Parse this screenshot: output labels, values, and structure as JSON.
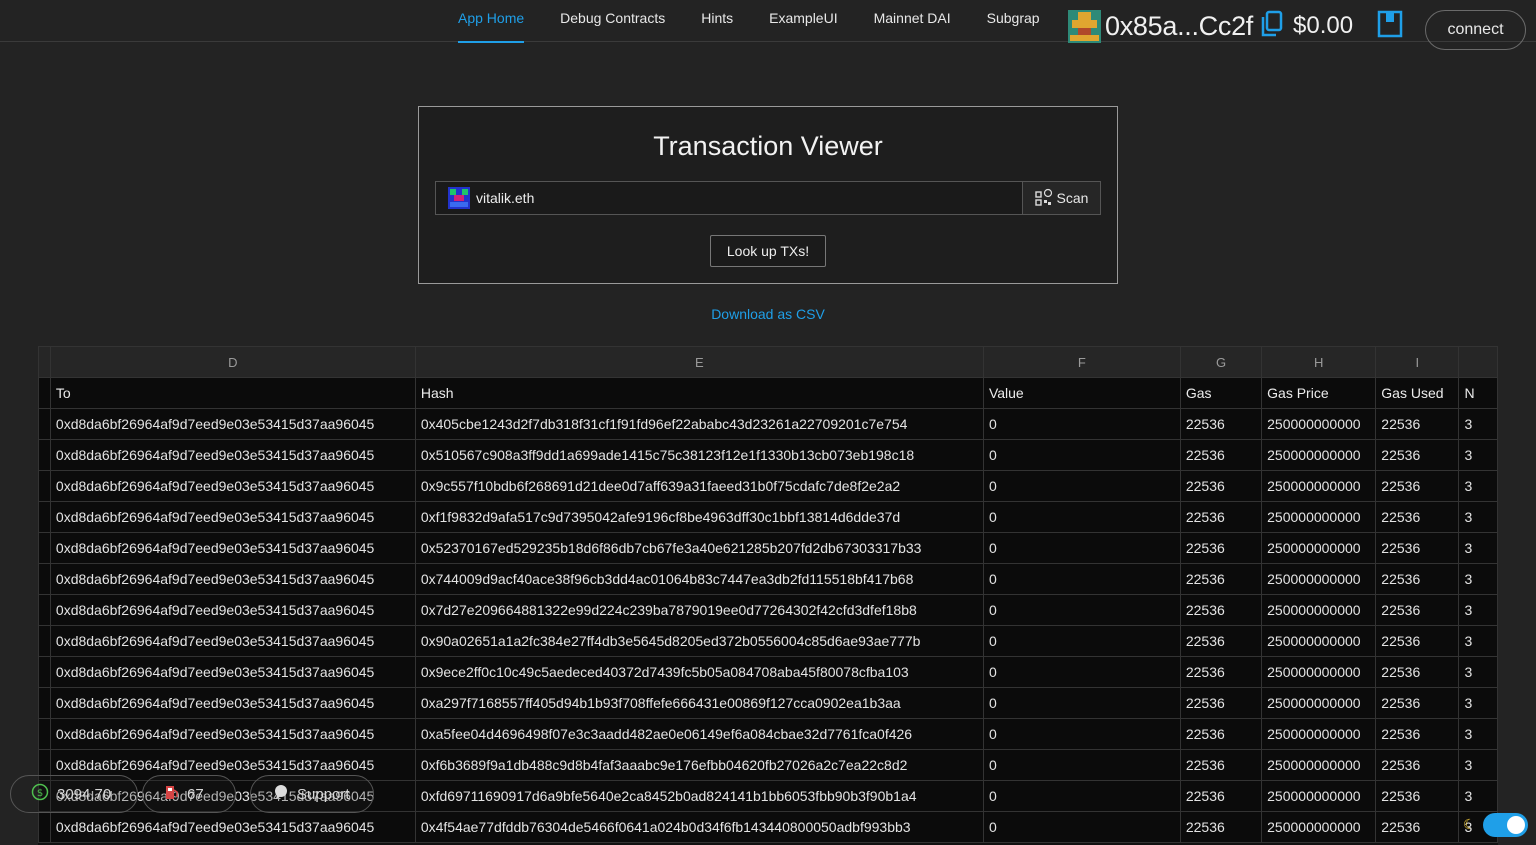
{
  "nav": {
    "tabs": [
      {
        "label": "App Home",
        "active": true
      },
      {
        "label": "Debug Contracts",
        "active": false
      },
      {
        "label": "Hints",
        "active": false
      },
      {
        "label": "ExampleUI",
        "active": false
      },
      {
        "label": "Mainnet DAI",
        "active": false
      },
      {
        "label": "Subgraph",
        "active": false
      }
    ]
  },
  "account": {
    "address": "0x85a...Cc2f",
    "balance": "$0.00",
    "connect_label": "connect",
    "icons": [
      "blockie-avatar",
      "copy-icon",
      "wallet-icon"
    ]
  },
  "card": {
    "title": "Transaction Viewer",
    "input_value": "vitalik.eth",
    "scan_label": "Scan",
    "lookup_label": "Look up TXs!"
  },
  "download_label": "Download as CSV",
  "sheet": {
    "column_letters": [
      "D",
      "E",
      "F",
      "G",
      "H",
      "I"
    ],
    "headers": [
      "To",
      "Hash",
      "Value",
      "Gas",
      "Gas Price",
      "Gas Used",
      "N"
    ],
    "rows": [
      {
        "to": "0xd8da6bf26964af9d7eed9e03e53415d37aa96045",
        "hash": "0x405cbe1243d2f7db318f31cf1f91fd96ef22ababc43d23261a22709201c7e754",
        "value": "0",
        "gas": "22536",
        "gas_price": "250000000000",
        "gas_used": "22536",
        "n": "3"
      },
      {
        "to": "0xd8da6bf26964af9d7eed9e03e53415d37aa96045",
        "hash": "0x510567c908a3ff9dd1a699ade1415c75c38123f12e1f1330b13cb073eb198c18",
        "value": "0",
        "gas": "22536",
        "gas_price": "250000000000",
        "gas_used": "22536",
        "n": "3"
      },
      {
        "to": "0xd8da6bf26964af9d7eed9e03e53415d37aa96045",
        "hash": "0x9c557f10bdb6f268691d21dee0d7aff639a31faeed31b0f75cdafc7de8f2e2a2",
        "value": "0",
        "gas": "22536",
        "gas_price": "250000000000",
        "gas_used": "22536",
        "n": "3"
      },
      {
        "to": "0xd8da6bf26964af9d7eed9e03e53415d37aa96045",
        "hash": "0xf1f9832d9afa517c9d7395042afe9196cf8be4963dff30c1bbf13814d6dde37d",
        "value": "0",
        "gas": "22536",
        "gas_price": "250000000000",
        "gas_used": "22536",
        "n": "3"
      },
      {
        "to": "0xd8da6bf26964af9d7eed9e03e53415d37aa96045",
        "hash": "0x52370167ed529235b18d6f86db7cb67fe3a40e621285b207fd2db67303317b33",
        "value": "0",
        "gas": "22536",
        "gas_price": "250000000000",
        "gas_used": "22536",
        "n": "3"
      },
      {
        "to": "0xd8da6bf26964af9d7eed9e03e53415d37aa96045",
        "hash": "0x744009d9acf40ace38f96cb3dd4ac01064b83c7447ea3db2fd115518bf417b68",
        "value": "0",
        "gas": "22536",
        "gas_price": "250000000000",
        "gas_used": "22536",
        "n": "3"
      },
      {
        "to": "0xd8da6bf26964af9d7eed9e03e53415d37aa96045",
        "hash": "0x7d27e209664881322e99d224c239ba7879019ee0d77264302f42cfd3dfef18b8",
        "value": "0",
        "gas": "22536",
        "gas_price": "250000000000",
        "gas_used": "22536",
        "n": "3"
      },
      {
        "to": "0xd8da6bf26964af9d7eed9e03e53415d37aa96045",
        "hash": "0x90a02651a1a2fc384e27ff4db3e5645d8205ed372b0556004c85d6ae93ae777b",
        "value": "0",
        "gas": "22536",
        "gas_price": "250000000000",
        "gas_used": "22536",
        "n": "3"
      },
      {
        "to": "0xd8da6bf26964af9d7eed9e03e53415d37aa96045",
        "hash": "0x9ece2ff0c10c49c5aedeced40372d7439fc5b05a084708aba45f80078cfba103",
        "value": "0",
        "gas": "22536",
        "gas_price": "250000000000",
        "gas_used": "22536",
        "n": "3"
      },
      {
        "to": "0xd8da6bf26964af9d7eed9e03e53415d37aa96045",
        "hash": "0xa297f7168557ff405d94b1b93f708ffefe666431e00869f127cca0902ea1b3aa",
        "value": "0",
        "gas": "22536",
        "gas_price": "250000000000",
        "gas_used": "22536",
        "n": "3"
      },
      {
        "to": "0xd8da6bf26964af9d7eed9e03e53415d37aa96045",
        "hash": "0xa5fee04d4696498f07e3c3aadd482ae0e06149ef6a084cbae32d7761fca0f426",
        "value": "0",
        "gas": "22536",
        "gas_price": "250000000000",
        "gas_used": "22536",
        "n": "3"
      },
      {
        "to": "0xd8da6bf26964af9d7eed9e03e53415d37aa96045",
        "hash": "0xf6b3689f9a1db488c9d8b4faf3aaabc9e176efbb04620fb27026a2c7ea22c8d2",
        "value": "0",
        "gas": "22536",
        "gas_price": "250000000000",
        "gas_used": "22536",
        "n": "3"
      },
      {
        "to": "0xd8da6bf26964af9d7eed9e03e53415d37aa96045",
        "hash": "0xfd69711690917d6a9bfe5640e2ca8452b0ad824141b1bb6053fbb90b3f90b1a4",
        "value": "0",
        "gas": "22536",
        "gas_price": "250000000000",
        "gas_used": "22536",
        "n": "3"
      },
      {
        "to": "0xd8da6bf26964af9d7eed9e03e53415d37aa96045",
        "hash": "0x4f54ae77dfddb76304de5466f0641a024b0d34f6fb143440800050adbf993bb3",
        "value": "0",
        "gas": "22536",
        "gas_price": "250000000000",
        "gas_used": "22536",
        "n": "3"
      }
    ]
  },
  "footer": {
    "eth_price": "3094.70",
    "gas_price": "67",
    "support_label": "Support"
  },
  "colors": {
    "accent": "#1f9fe8",
    "background": "#232323"
  }
}
